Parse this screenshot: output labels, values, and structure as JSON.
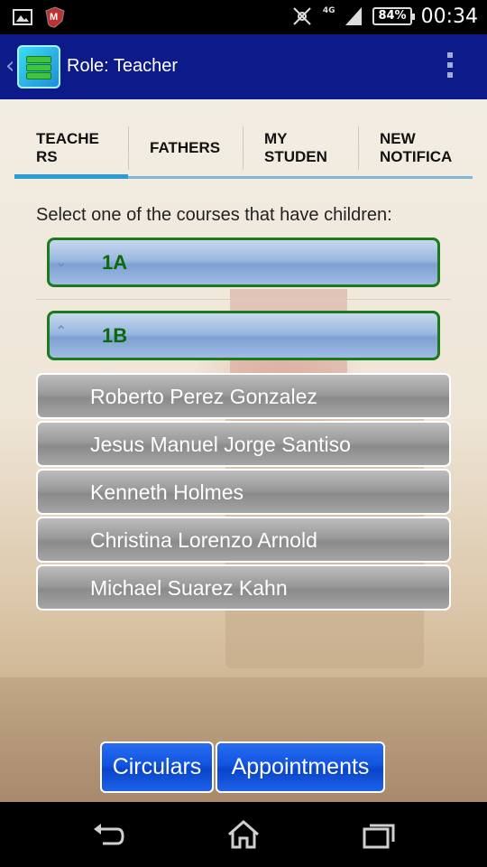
{
  "status_bar": {
    "network": "4G",
    "battery": "84%",
    "time": "00:34",
    "icons": [
      "image-icon",
      "mcafee-icon",
      "mute-icon",
      "signal-icon"
    ]
  },
  "app_bar": {
    "title": "Role: Teacher",
    "icons": [
      "back-icon",
      "app-logo-icon",
      "overflow-menu-icon"
    ]
  },
  "tabs": [
    {
      "label": "TEACHE\nRS",
      "active": true
    },
    {
      "label": "FATHERS",
      "active": false
    },
    {
      "label": "MY\nSTUDEN",
      "active": false
    },
    {
      "label": "NEW\nNOTIFICA",
      "active": false
    }
  ],
  "instruction": "Select one of the courses that have children:",
  "courses": [
    {
      "label": "1A",
      "expanded": false
    },
    {
      "label": "1B",
      "expanded": true
    }
  ],
  "students": [
    "Roberto Perez Gonzalez",
    "Jesus Manuel Jorge Santiso",
    "Kenneth Holmes",
    "Christina Lorenzo Arnold",
    "Michael Suarez Kahn"
  ],
  "buttons": {
    "circulars": "Circulars",
    "appointments": "Appointments"
  },
  "colors": {
    "app_bar": "#0d1b8a",
    "tab_indicator": "#2a9cd8",
    "course_text": "#0a6a0a",
    "button_blue": "#1055e0"
  }
}
